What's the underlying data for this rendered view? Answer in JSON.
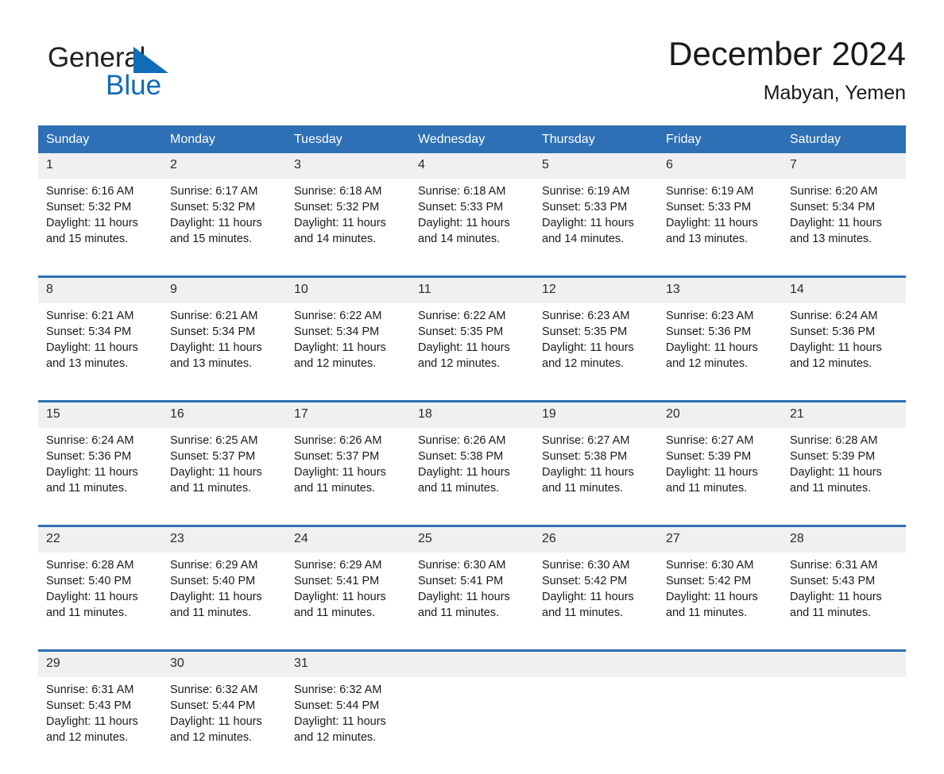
{
  "brand": {
    "name_top": "General",
    "name_bottom": "Blue",
    "color_text": "#231f20",
    "color_accent": "#0f6cb6"
  },
  "header": {
    "title": "December 2024",
    "location": "Mabyan, Yemen"
  },
  "colors": {
    "header_band": "#2E70B5",
    "date_band": "#f0f0f0",
    "cell_bg": "#ffffff"
  },
  "weekday_headers": [
    "Sunday",
    "Monday",
    "Tuesday",
    "Wednesday",
    "Thursday",
    "Friday",
    "Saturday"
  ],
  "weeks": [
    {
      "days": [
        {
          "date": "1",
          "sunrise": "Sunrise: 6:16 AM",
          "sunset": "Sunset: 5:32 PM",
          "daylight_line1": "Daylight: 11 hours",
          "daylight_line2": "and 15 minutes."
        },
        {
          "date": "2",
          "sunrise": "Sunrise: 6:17 AM",
          "sunset": "Sunset: 5:32 PM",
          "daylight_line1": "Daylight: 11 hours",
          "daylight_line2": "and 15 minutes."
        },
        {
          "date": "3",
          "sunrise": "Sunrise: 6:18 AM",
          "sunset": "Sunset: 5:32 PM",
          "daylight_line1": "Daylight: 11 hours",
          "daylight_line2": "and 14 minutes."
        },
        {
          "date": "4",
          "sunrise": "Sunrise: 6:18 AM",
          "sunset": "Sunset: 5:33 PM",
          "daylight_line1": "Daylight: 11 hours",
          "daylight_line2": "and 14 minutes."
        },
        {
          "date": "5",
          "sunrise": "Sunrise: 6:19 AM",
          "sunset": "Sunset: 5:33 PM",
          "daylight_line1": "Daylight: 11 hours",
          "daylight_line2": "and 14 minutes."
        },
        {
          "date": "6",
          "sunrise": "Sunrise: 6:19 AM",
          "sunset": "Sunset: 5:33 PM",
          "daylight_line1": "Daylight: 11 hours",
          "daylight_line2": "and 13 minutes."
        },
        {
          "date": "7",
          "sunrise": "Sunrise: 6:20 AM",
          "sunset": "Sunset: 5:34 PM",
          "daylight_line1": "Daylight: 11 hours",
          "daylight_line2": "and 13 minutes."
        }
      ]
    },
    {
      "days": [
        {
          "date": "8",
          "sunrise": "Sunrise: 6:21 AM",
          "sunset": "Sunset: 5:34 PM",
          "daylight_line1": "Daylight: 11 hours",
          "daylight_line2": "and 13 minutes."
        },
        {
          "date": "9",
          "sunrise": "Sunrise: 6:21 AM",
          "sunset": "Sunset: 5:34 PM",
          "daylight_line1": "Daylight: 11 hours",
          "daylight_line2": "and 13 minutes."
        },
        {
          "date": "10",
          "sunrise": "Sunrise: 6:22 AM",
          "sunset": "Sunset: 5:34 PM",
          "daylight_line1": "Daylight: 11 hours",
          "daylight_line2": "and 12 minutes."
        },
        {
          "date": "11",
          "sunrise": "Sunrise: 6:22 AM",
          "sunset": "Sunset: 5:35 PM",
          "daylight_line1": "Daylight: 11 hours",
          "daylight_line2": "and 12 minutes."
        },
        {
          "date": "12",
          "sunrise": "Sunrise: 6:23 AM",
          "sunset": "Sunset: 5:35 PM",
          "daylight_line1": "Daylight: 11 hours",
          "daylight_line2": "and 12 minutes."
        },
        {
          "date": "13",
          "sunrise": "Sunrise: 6:23 AM",
          "sunset": "Sunset: 5:36 PM",
          "daylight_line1": "Daylight: 11 hours",
          "daylight_line2": "and 12 minutes."
        },
        {
          "date": "14",
          "sunrise": "Sunrise: 6:24 AM",
          "sunset": "Sunset: 5:36 PM",
          "daylight_line1": "Daylight: 11 hours",
          "daylight_line2": "and 12 minutes."
        }
      ]
    },
    {
      "days": [
        {
          "date": "15",
          "sunrise": "Sunrise: 6:24 AM",
          "sunset": "Sunset: 5:36 PM",
          "daylight_line1": "Daylight: 11 hours",
          "daylight_line2": "and 11 minutes."
        },
        {
          "date": "16",
          "sunrise": "Sunrise: 6:25 AM",
          "sunset": "Sunset: 5:37 PM",
          "daylight_line1": "Daylight: 11 hours",
          "daylight_line2": "and 11 minutes."
        },
        {
          "date": "17",
          "sunrise": "Sunrise: 6:26 AM",
          "sunset": "Sunset: 5:37 PM",
          "daylight_line1": "Daylight: 11 hours",
          "daylight_line2": "and 11 minutes."
        },
        {
          "date": "18",
          "sunrise": "Sunrise: 6:26 AM",
          "sunset": "Sunset: 5:38 PM",
          "daylight_line1": "Daylight: 11 hours",
          "daylight_line2": "and 11 minutes."
        },
        {
          "date": "19",
          "sunrise": "Sunrise: 6:27 AM",
          "sunset": "Sunset: 5:38 PM",
          "daylight_line1": "Daylight: 11 hours",
          "daylight_line2": "and 11 minutes."
        },
        {
          "date": "20",
          "sunrise": "Sunrise: 6:27 AM",
          "sunset": "Sunset: 5:39 PM",
          "daylight_line1": "Daylight: 11 hours",
          "daylight_line2": "and 11 minutes."
        },
        {
          "date": "21",
          "sunrise": "Sunrise: 6:28 AM",
          "sunset": "Sunset: 5:39 PM",
          "daylight_line1": "Daylight: 11 hours",
          "daylight_line2": "and 11 minutes."
        }
      ]
    },
    {
      "days": [
        {
          "date": "22",
          "sunrise": "Sunrise: 6:28 AM",
          "sunset": "Sunset: 5:40 PM",
          "daylight_line1": "Daylight: 11 hours",
          "daylight_line2": "and 11 minutes."
        },
        {
          "date": "23",
          "sunrise": "Sunrise: 6:29 AM",
          "sunset": "Sunset: 5:40 PM",
          "daylight_line1": "Daylight: 11 hours",
          "daylight_line2": "and 11 minutes."
        },
        {
          "date": "24",
          "sunrise": "Sunrise: 6:29 AM",
          "sunset": "Sunset: 5:41 PM",
          "daylight_line1": "Daylight: 11 hours",
          "daylight_line2": "and 11 minutes."
        },
        {
          "date": "25",
          "sunrise": "Sunrise: 6:30 AM",
          "sunset": "Sunset: 5:41 PM",
          "daylight_line1": "Daylight: 11 hours",
          "daylight_line2": "and 11 minutes."
        },
        {
          "date": "26",
          "sunrise": "Sunrise: 6:30 AM",
          "sunset": "Sunset: 5:42 PM",
          "daylight_line1": "Daylight: 11 hours",
          "daylight_line2": "and 11 minutes."
        },
        {
          "date": "27",
          "sunrise": "Sunrise: 6:30 AM",
          "sunset": "Sunset: 5:42 PM",
          "daylight_line1": "Daylight: 11 hours",
          "daylight_line2": "and 11 minutes."
        },
        {
          "date": "28",
          "sunrise": "Sunrise: 6:31 AM",
          "sunset": "Sunset: 5:43 PM",
          "daylight_line1": "Daylight: 11 hours",
          "daylight_line2": "and 11 minutes."
        }
      ]
    },
    {
      "days": [
        {
          "date": "29",
          "sunrise": "Sunrise: 6:31 AM",
          "sunset": "Sunset: 5:43 PM",
          "daylight_line1": "Daylight: 11 hours",
          "daylight_line2": "and 12 minutes."
        },
        {
          "date": "30",
          "sunrise": "Sunrise: 6:32 AM",
          "sunset": "Sunset: 5:44 PM",
          "daylight_line1": "Daylight: 11 hours",
          "daylight_line2": "and 12 minutes."
        },
        {
          "date": "31",
          "sunrise": "Sunrise: 6:32 AM",
          "sunset": "Sunset: 5:44 PM",
          "daylight_line1": "Daylight: 11 hours",
          "daylight_line2": "and 12 minutes."
        },
        {
          "date": "",
          "sunrise": "",
          "sunset": "",
          "daylight_line1": "",
          "daylight_line2": ""
        },
        {
          "date": "",
          "sunrise": "",
          "sunset": "",
          "daylight_line1": "",
          "daylight_line2": ""
        },
        {
          "date": "",
          "sunrise": "",
          "sunset": "",
          "daylight_line1": "",
          "daylight_line2": ""
        },
        {
          "date": "",
          "sunrise": "",
          "sunset": "",
          "daylight_line1": "",
          "daylight_line2": ""
        }
      ]
    }
  ]
}
